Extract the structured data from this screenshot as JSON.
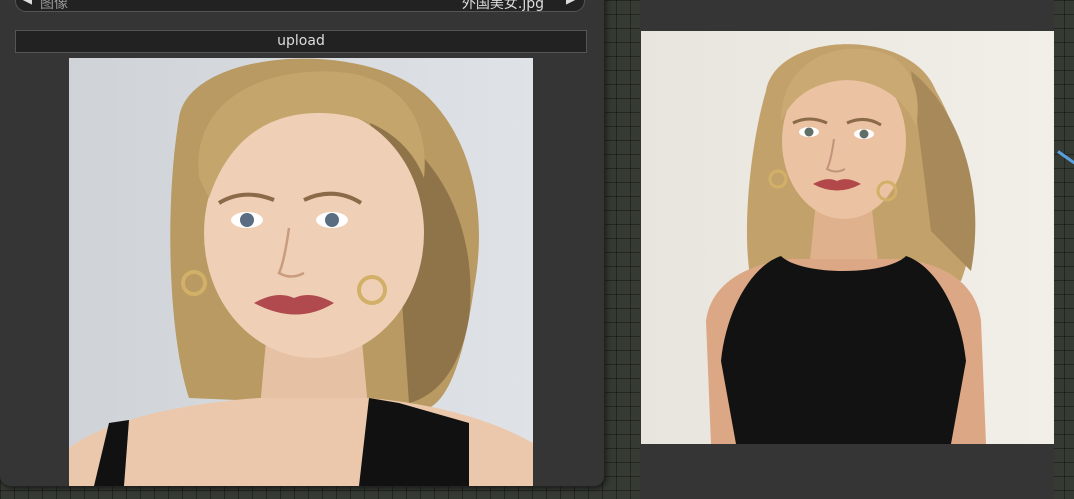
{
  "node": {
    "image_label": "图像",
    "image_value": "外国美女.jpg",
    "prev_arrow": "◀",
    "next_arrow": "▶",
    "upload_label": "upload"
  },
  "colors": {
    "canvas": "#353a33",
    "node_bg": "#353535",
    "widget_bg": "#222222",
    "wire": "#5aa0e0"
  }
}
